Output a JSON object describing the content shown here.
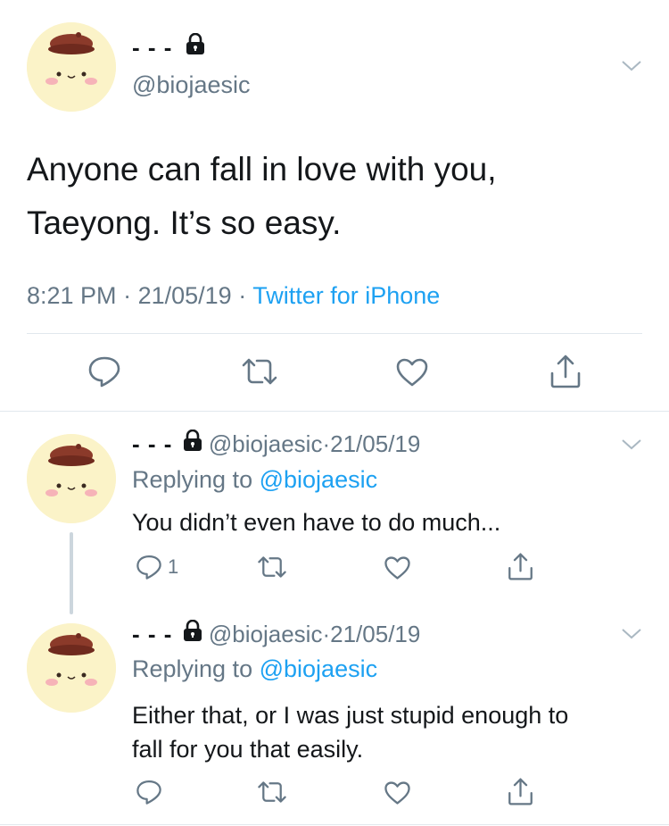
{
  "main_tweet": {
    "display_name": "- - -",
    "handle": "@biojaesic",
    "text_line1": "Anyone can fall in love with you,",
    "text_line2": "Taeyong. It’s so easy.",
    "time": "8:21 PM",
    "date": "21/05/19",
    "source": "Twitter for iPhone",
    "separator": "·"
  },
  "replies": [
    {
      "display_name": "- - -",
      "handle": "@biojaesic",
      "date": "21/05/19",
      "replying_label": "Replying to",
      "replying_to": "@biojaesic",
      "text_line1": "You didn’t even have to do much...",
      "text_line2": "",
      "reply_count": "1",
      "separator": "·"
    },
    {
      "display_name": "- - -",
      "handle": "@biojaesic",
      "date": "21/05/19",
      "replying_label": "Replying to",
      "replying_to": "@biojaesic",
      "text_line1": "Either that, or I was just stupid enough to",
      "text_line2": "fall for you that easily.",
      "reply_count": "",
      "separator": "·"
    }
  ],
  "colors": {
    "accent": "#1da1f2",
    "meta_grey": "#657786",
    "icon_grey": "#657786",
    "divider": "#e1e8ed"
  },
  "icons": [
    "lock-icon",
    "chevron-down-icon",
    "reply-icon",
    "retweet-icon",
    "like-icon",
    "share-icon"
  ]
}
